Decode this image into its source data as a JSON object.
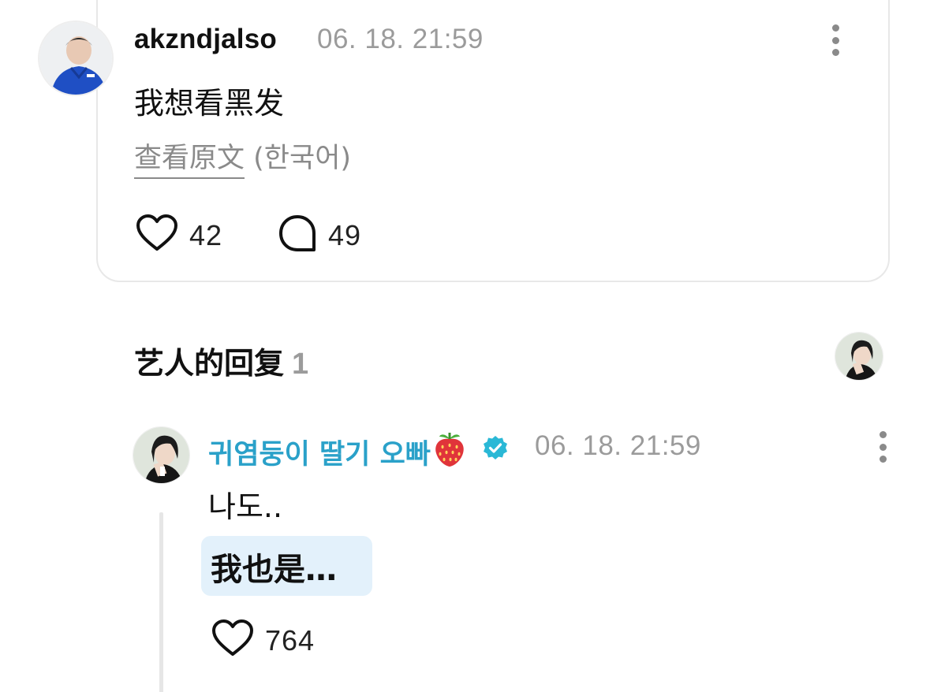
{
  "comment": {
    "username": "akzndjalso",
    "timestamp": "06. 18. 21:59",
    "text": "我想看黑发",
    "see_original_label": "查看原文",
    "original_language": "(한국어)",
    "likes": "42",
    "replies": "49"
  },
  "artist_replies": {
    "title": "艺人的回复",
    "count": "1"
  },
  "reply": {
    "artist_name": "귀염둥이 딸기 오빠",
    "timestamp": "06. 18. 21:59",
    "text": "나도..",
    "translation": "我也是…",
    "likes": "764",
    "verified_color": "#2ab8d6",
    "name_color": "#2aa1c9"
  },
  "icons": {
    "like": "heart-outline-icon",
    "comment": "speech-bubble-icon",
    "more": "vertical-ellipsis-icon",
    "verified": "verified-badge-icon",
    "strawberry": "strawberry-emoji"
  }
}
